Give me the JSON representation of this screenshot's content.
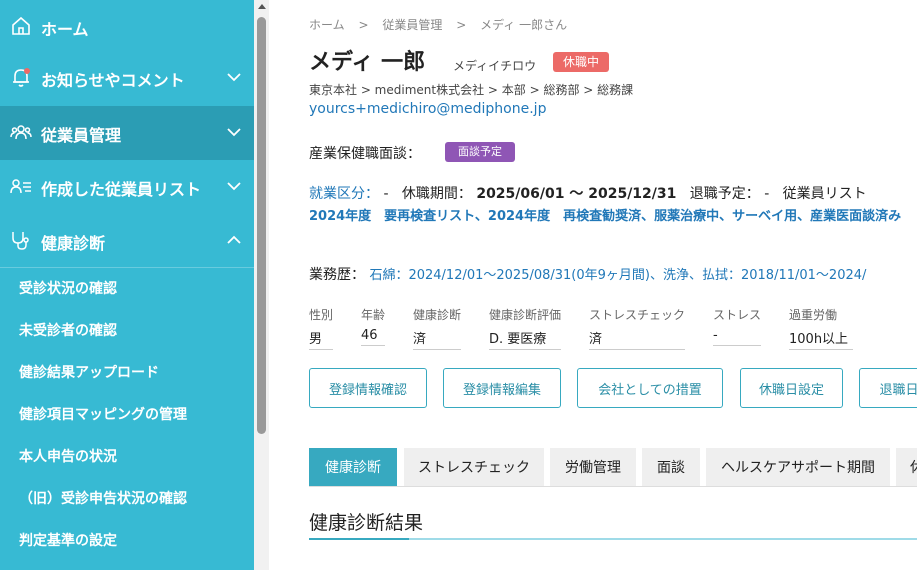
{
  "sidebar": {
    "items": [
      {
        "label": "ホーム",
        "icon": "home-icon"
      },
      {
        "label": "お知らせやコメント",
        "icon": "bell-icon"
      },
      {
        "label": "従業員管理",
        "icon": "users-icon"
      },
      {
        "label": "作成した従業員リスト",
        "icon": "user-list-icon"
      },
      {
        "label": "健康診断",
        "icon": "stethoscope-icon"
      }
    ],
    "sub_items": [
      "受診状況の確認",
      "未受診者の確認",
      "健診結果アップロード",
      "健診項目マッピングの管理",
      "本人申告の状況",
      "（旧）受診申告状況の確認",
      "判定基準の設定"
    ]
  },
  "breadcrumb": [
    "ホーム",
    ">",
    "従業員管理",
    ">",
    "メディ 一郎さん"
  ],
  "employee": {
    "name": "メディ 一郎",
    "kana": "メディイチロウ",
    "status": "休職中",
    "org": "東京本社 > mediment株式会社 > 本部 > 総務部 > 総務課",
    "email": "yourcs+medichiro@mediphone.jp",
    "sangyo_label": "産業保健職面談：",
    "mendan_badge": "面談予定"
  },
  "work": {
    "kubun_label": "就業区分：",
    "kubun_value": "-",
    "leave_label": "休職期間：",
    "leave_value": "2025/06/01 ～ 2025/12/31",
    "retire_label": "退職予定：",
    "retire_value": "-",
    "list_label": "従業員リスト",
    "tags": "2024年度　要再検査リスト、2024年度　再検査勧奨済、服薬治療中、サーベイ用、産業医面談済み",
    "career_label": "業務歴：",
    "career_value": "石綿：2024/12/01～2025/08/31(0年9ヶ月間)、洗浄、払拭：2018/11/01～2024/"
  },
  "fields": [
    {
      "label": "性別",
      "value": "男"
    },
    {
      "label": "年齢",
      "value": "46"
    },
    {
      "label": "健康診断",
      "value": "済"
    },
    {
      "label": "健康診断評価",
      "value": "D. 要医療"
    },
    {
      "label": "ストレスチェック",
      "value": "済"
    },
    {
      "label": "ストレス",
      "value": "-"
    },
    {
      "label": "過重労働",
      "value": "100h以上"
    }
  ],
  "buttons": [
    "登録情報確認",
    "登録情報編集",
    "会社としての措置",
    "休職日設定",
    "退職日"
  ],
  "tabs": [
    "健康診断",
    "ストレスチェック",
    "労働管理",
    "面談",
    "ヘルスケアサポート期間",
    "休"
  ],
  "section_title": "健康診断結果",
  "colors": {
    "sidebar": "#37bad3",
    "sidebar_active": "#2b9db4",
    "accent": "#37a9c0",
    "leave_badge": "#ec6a67",
    "mendan_badge": "#8f56b5",
    "link": "#2178b8"
  }
}
